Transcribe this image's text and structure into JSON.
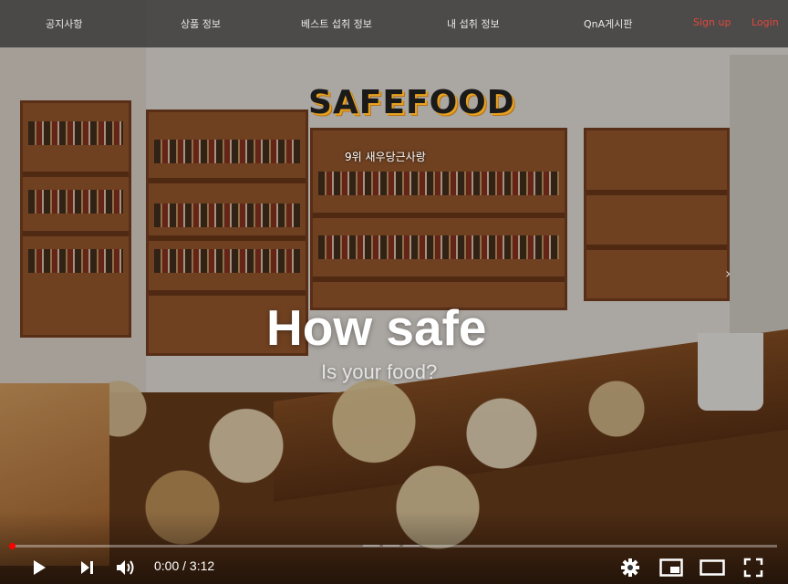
{
  "nav": {
    "items": [
      "공지사항",
      "상품 정보",
      "베스트 섭취 정보",
      "내 섭취 정보",
      "QnA게시판"
    ],
    "signup": "Sign up",
    "login": "Login"
  },
  "hero": {
    "logo": "SAFEFOOD",
    "rank_text": "9위 새우당근사랑",
    "headline": "How safe",
    "subline": "Is your food?"
  },
  "player": {
    "time_current": "0:00",
    "time_separator": "/",
    "time_total": "3:12",
    "progress": 0.0,
    "icons": [
      "play-icon",
      "next-icon",
      "volume-icon",
      "settings-icon",
      "miniplayer-icon",
      "theater-icon",
      "fullscreen-icon"
    ]
  },
  "colors": {
    "auth_link": "#e0483c",
    "progress": "#ff0000",
    "logo_shadow": "#e8a320"
  }
}
